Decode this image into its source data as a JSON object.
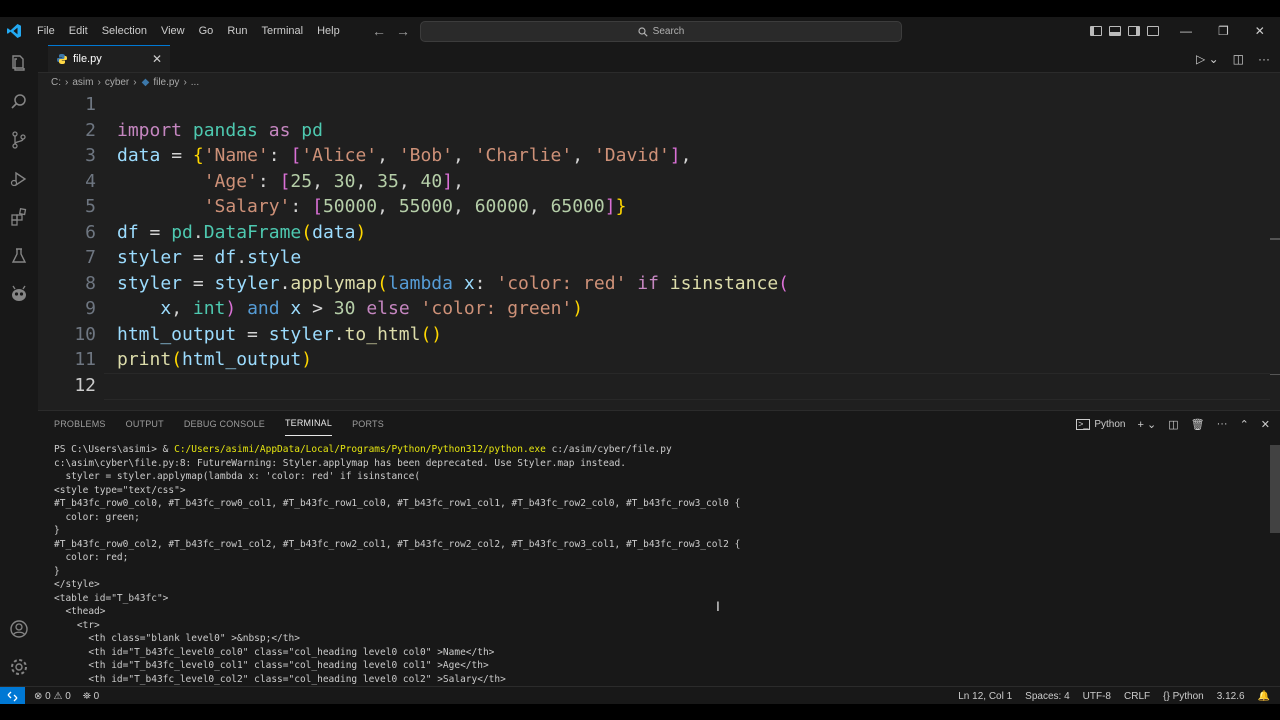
{
  "window": {
    "menu": [
      "File",
      "Edit",
      "Selection",
      "View",
      "Go",
      "Run",
      "Terminal",
      "Help"
    ],
    "search_label": "Search"
  },
  "tab": {
    "label": "file.py",
    "close": "✕"
  },
  "breadcrumb": [
    "C:",
    "asim",
    "cyber",
    "file.py",
    "..."
  ],
  "editor": {
    "lines": [
      {
        "n": "1",
        "text": ""
      },
      {
        "n": "2",
        "text": "import pandas as pd"
      },
      {
        "n": "3",
        "text": "data = {'Name': ['Alice', 'Bob', 'Charlie', 'David'],"
      },
      {
        "n": "4",
        "text": "        'Age': [25, 30, 35, 40],"
      },
      {
        "n": "5",
        "text": "        'Salary': [50000, 55000, 60000, 65000]}"
      },
      {
        "n": "6",
        "text": "df = pd.DataFrame(data)"
      },
      {
        "n": "7",
        "text": "styler = df.style"
      },
      {
        "n": "8",
        "text": "styler = styler.applymap(lambda x: 'color: red' if isinstance("
      },
      {
        "n": "9",
        "text": "    x, int) and x > 30 else 'color: green')"
      },
      {
        "n": "10",
        "text": "html_output = styler.to_html()"
      },
      {
        "n": "11",
        "text": "print(html_output)"
      },
      {
        "n": "12",
        "text": ""
      }
    ]
  },
  "panel": {
    "tabs": [
      "PROBLEMS",
      "OUTPUT",
      "DEBUG CONSOLE",
      "TERMINAL",
      "PORTS"
    ],
    "active_tab": "TERMINAL",
    "shell_label": "Python"
  },
  "terminal": {
    "prompt": "PS C:\\Users\\asimi> & ",
    "command_path": "C:/Users/asimi/AppData/Local/Programs/Python/Python312/python.exe",
    "command_arg": " c:/asim/cyber/file.py",
    "lines": [
      "c:\\asim\\cyber\\file.py:8: FutureWarning: Styler.applymap has been deprecated. Use Styler.map instead.",
      "  styler = styler.applymap(lambda x: 'color: red' if isinstance(",
      "<style type=\"text/css\">",
      "#T_b43fc_row0_col0, #T_b43fc_row0_col1, #T_b43fc_row1_col0, #T_b43fc_row1_col1, #T_b43fc_row2_col0, #T_b43fc_row3_col0 {",
      "  color: green;",
      "}",
      "#T_b43fc_row0_col2, #T_b43fc_row1_col2, #T_b43fc_row2_col1, #T_b43fc_row2_col2, #T_b43fc_row3_col1, #T_b43fc_row3_col2 {",
      "  color: red;",
      "}",
      "</style>",
      "<table id=\"T_b43fc\">",
      "  <thead>",
      "    <tr>",
      "      <th class=\"blank level0\" >&nbsp;</th>",
      "      <th id=\"T_b43fc_level0_col0\" class=\"col_heading level0 col0\" >Name</th>",
      "      <th id=\"T_b43fc_level0_col1\" class=\"col_heading level0 col1\" >Age</th>",
      "      <th id=\"T_b43fc_level0_col2\" class=\"col_heading level0 col2\" >Salary</th>"
    ]
  },
  "status": {
    "errors": "0",
    "warnings": "0",
    "ports": "0",
    "position": "Ln 12, Col 1",
    "spaces": "Spaces: 4",
    "encoding": "UTF-8",
    "eol": "CRLF",
    "language_bracket": "{}",
    "language": "Python",
    "version": "3.12.6"
  },
  "colors": {
    "accent": "#0078d4",
    "background": "#1f1f1f"
  }
}
